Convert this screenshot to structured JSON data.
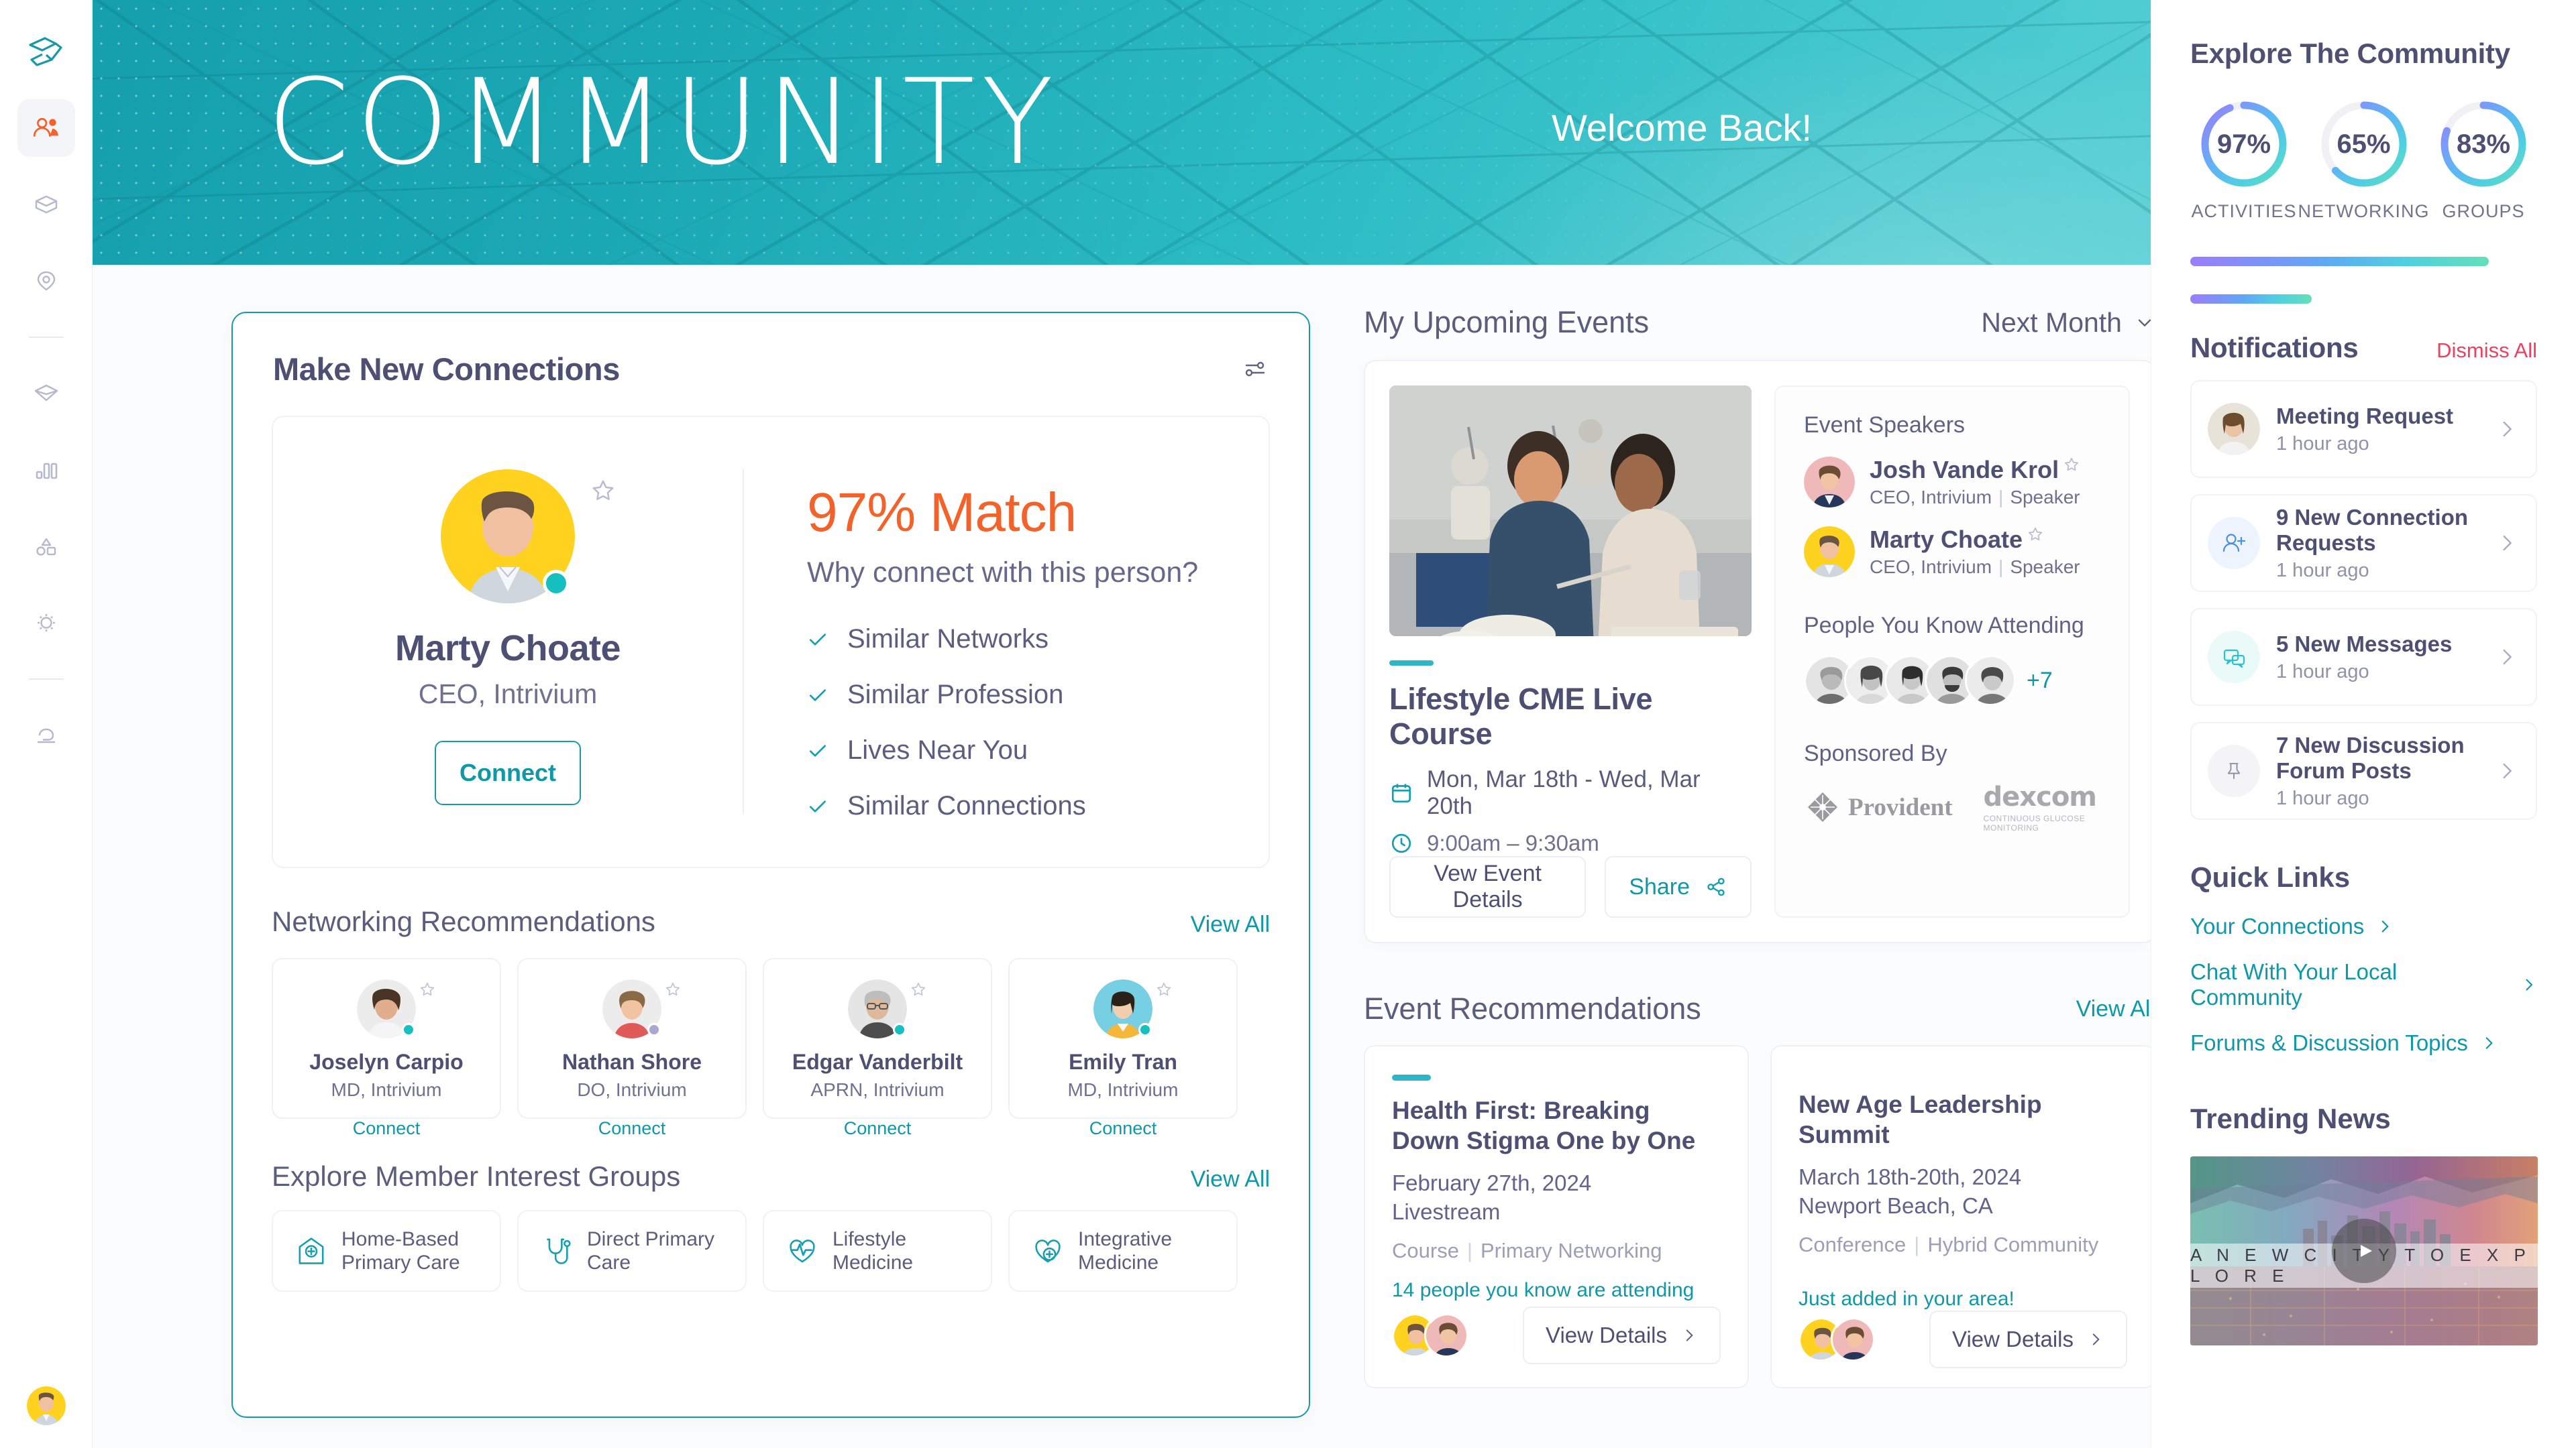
{
  "sidebar": {
    "logo_icon": "intrivium-logo",
    "items": [
      {
        "name": "community",
        "icon": "people-icon",
        "active": true
      },
      {
        "name": "products",
        "icon": "box-icon",
        "active": false
      },
      {
        "name": "locations",
        "icon": "map-pin-icon",
        "active": false
      },
      {
        "name": "rewards",
        "icon": "diamond-icon",
        "active": false
      },
      {
        "name": "analytics",
        "icon": "bar-chart-icon",
        "active": false
      },
      {
        "name": "shapes",
        "icon": "shapes-icon",
        "active": false
      },
      {
        "name": "settings",
        "icon": "gear-icon",
        "active": false
      },
      {
        "name": "support",
        "icon": "support-icon",
        "active": false
      }
    ],
    "user_avatar": "user-avatar"
  },
  "hero": {
    "title": "COMMUNITY",
    "welcome": "Welcome Back!"
  },
  "connections_panel": {
    "title": "Make New Connections",
    "filter_icon": "sliders-icon",
    "featured": {
      "name": "Marty Choate",
      "role": "CEO, Intrivium",
      "connect_label": "Connect",
      "match_percent": "97% Match",
      "why_label": "Why connect with this person?",
      "reasons": [
        "Similar Networks",
        "Similar Profession",
        "Lives Near You",
        "Similar Connections"
      ]
    },
    "recommendations": {
      "title": "Networking Recommendations",
      "view_all": "View All",
      "people": [
        {
          "name": "Joselyn Carpio",
          "role": "MD, Intrivium",
          "connect": "Connect",
          "status": "online"
        },
        {
          "name": "Nathan Shore",
          "role": "DO, Intrivium",
          "connect": "Connect",
          "status": "away"
        },
        {
          "name": "Edgar Vanderbilt",
          "role": "APRN, Intrivium",
          "connect": "Connect",
          "status": "online"
        },
        {
          "name": "Emily Tran",
          "role": "MD, Intrivium",
          "connect": "Connect",
          "status": "online"
        }
      ]
    },
    "interest_groups": {
      "title": "Explore Member Interest Groups",
      "view_all": "View All",
      "groups": [
        {
          "label": "Home-Based\nPrimary Care",
          "icon": "home-health-icon"
        },
        {
          "label": "Direct Primary\nCare",
          "icon": "stethoscope-icon"
        },
        {
          "label": "Lifestyle\nMedicine",
          "icon": "heart-pulse-icon"
        },
        {
          "label": "Integrative\nMedicine",
          "icon": "heart-plus-icon"
        }
      ]
    }
  },
  "upcoming_events": {
    "title": "My Upcoming Events",
    "filter_value": "Next Month",
    "filter_icon": "chevron-down-icon",
    "event": {
      "title": "Lifestyle CME Live Course",
      "date": "Mon, Mar 18th  -  Wed, Mar 20th",
      "time": "9:00am – 9:30am",
      "date_icon": "calendar-icon",
      "time_icon": "clock-icon",
      "details_label": "Vew Event Details",
      "share_label": "Share",
      "share_icon": "share-icon",
      "speakers_label": "Event Speakers",
      "speakers": [
        {
          "name": "Josh Vande Krol",
          "role": "CEO, Intrivium",
          "tag": "Speaker"
        },
        {
          "name": "Marty Choate",
          "role": "CEO, Intrivium",
          "tag": "Speaker"
        }
      ],
      "attending_label": "People You Know Attending",
      "attending_more": "+7",
      "sponsored_label": "Sponsored By",
      "sponsors": [
        {
          "name": "Provident"
        },
        {
          "name": "dexcom",
          "tagline": "CONTINUOUS GLUCOSE MONITORING"
        }
      ]
    }
  },
  "event_recommendations": {
    "title": "Event Recommendations",
    "view_all": "View All",
    "cards": [
      {
        "accent": "#2eb6c8",
        "title": "Health First: Breaking Down Stigma One by One",
        "date": "February 27th, 2024",
        "location": "Livestream",
        "tag1": "Course",
        "tag2": "Primary Networking",
        "note": "14 people you know are attending",
        "button": "View Details"
      },
      {
        "accent": "#5fcfa0",
        "title": "New Age Leadership Summit",
        "date": "March 18th-20th, 2024",
        "location": "Newport Beach, CA",
        "tag1": "Conference",
        "tag2": "Hybrid Community",
        "note": "Just added in your area!",
        "button": "View Details"
      }
    ]
  },
  "right_panel": {
    "explore_title": "Explore The Community",
    "rings": [
      {
        "value": "97%",
        "label": "ACTIVITIES",
        "pct": 97
      },
      {
        "value": "65%",
        "label": "NETWORKING",
        "pct": 65
      },
      {
        "value": "83%",
        "label": "GROUPS",
        "pct": 83
      }
    ],
    "progress_bars": [
      {
        "pct": 86
      },
      {
        "pct": 35
      }
    ],
    "notifications_title": "Notifications",
    "dismiss_all": "Dismiss All",
    "notifications": [
      {
        "title": "Meeting Request",
        "time": "1 hour ago",
        "icon": "avatar-photo"
      },
      {
        "title": "9 New Connection Requests",
        "time": "1 hour ago",
        "icon": "person-add-icon"
      },
      {
        "title": "5 New Messages",
        "time": "1 hour ago",
        "icon": "chat-bubbles-icon"
      },
      {
        "title": "7 New Discussion Forum Posts",
        "time": "1 hour ago",
        "icon": "pin-icon"
      }
    ],
    "quick_links_title": "Quick Links",
    "quick_links": [
      "Your Connections",
      "Chat With Your Local Community",
      "Forums & Discussion Topics"
    ],
    "trending_title": "Trending News",
    "trending_video": {
      "caption": "A  N E W   C I T Y   T O   E X P L O R E",
      "play_icon": "play-icon"
    }
  },
  "colors": {
    "brand_teal": "#1899a8",
    "accent_orange": "#f4622a",
    "text_dark": "#4d5072",
    "danger": "#f04060"
  }
}
